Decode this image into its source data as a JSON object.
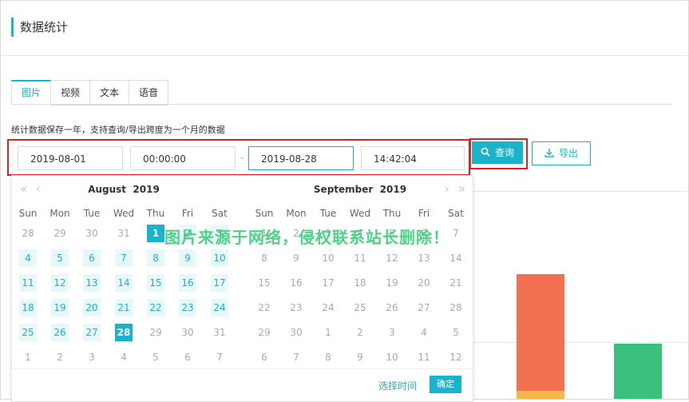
{
  "page": {
    "title": "数据统计"
  },
  "tabs": [
    {
      "label": "图片",
      "active": true
    },
    {
      "label": "视频",
      "active": false
    },
    {
      "label": "文本",
      "active": false
    },
    {
      "label": "语音",
      "active": false
    }
  ],
  "hint": "统计数据保存一年，支持查询/导出跨度为一个月的数据",
  "range": {
    "start_date": "2019-08-01",
    "start_time": "00:00:00",
    "separator": "-",
    "end_date": "2019-08-28",
    "end_time": "14:42:04"
  },
  "buttons": {
    "query": "查询",
    "export": "导出"
  },
  "calendar": {
    "weekdays": [
      "Sun",
      "Mon",
      "Tue",
      "Wed",
      "Thu",
      "Fri",
      "Sat"
    ],
    "left": {
      "month": "August",
      "year": "2019",
      "days": [
        {
          "n": "28",
          "s": "dim"
        },
        {
          "n": "29",
          "s": "dim"
        },
        {
          "n": "30",
          "s": "dim"
        },
        {
          "n": "31",
          "s": "dim"
        },
        {
          "n": "1",
          "s": "sel"
        },
        {
          "n": "2",
          "s": "cur"
        },
        {
          "n": "3",
          "s": "cur"
        },
        {
          "n": "4",
          "s": "cur"
        },
        {
          "n": "5",
          "s": "cur"
        },
        {
          "n": "6",
          "s": "cur"
        },
        {
          "n": "7",
          "s": "cur"
        },
        {
          "n": "8",
          "s": "cur"
        },
        {
          "n": "9",
          "s": "cur"
        },
        {
          "n": "10",
          "s": "cur"
        },
        {
          "n": "11",
          "s": "cur"
        },
        {
          "n": "12",
          "s": "cur"
        },
        {
          "n": "13",
          "s": "cur"
        },
        {
          "n": "14",
          "s": "cur"
        },
        {
          "n": "15",
          "s": "cur"
        },
        {
          "n": "16",
          "s": "cur"
        },
        {
          "n": "17",
          "s": "cur"
        },
        {
          "n": "18",
          "s": "cur"
        },
        {
          "n": "19",
          "s": "cur"
        },
        {
          "n": "20",
          "s": "cur"
        },
        {
          "n": "21",
          "s": "cur"
        },
        {
          "n": "22",
          "s": "cur"
        },
        {
          "n": "23",
          "s": "cur"
        },
        {
          "n": "24",
          "s": "cur"
        },
        {
          "n": "25",
          "s": "cur"
        },
        {
          "n": "26",
          "s": "cur"
        },
        {
          "n": "27",
          "s": "cur"
        },
        {
          "n": "28",
          "s": "sel"
        },
        {
          "n": "29",
          "s": "dim"
        },
        {
          "n": "30",
          "s": "dim"
        },
        {
          "n": "31",
          "s": "dim"
        },
        {
          "n": "1",
          "s": "dim"
        },
        {
          "n": "2",
          "s": "dim"
        },
        {
          "n": "3",
          "s": "dim"
        },
        {
          "n": "4",
          "s": "dim"
        },
        {
          "n": "5",
          "s": "dim"
        },
        {
          "n": "6",
          "s": "dim"
        },
        {
          "n": "7",
          "s": "dim"
        }
      ]
    },
    "right": {
      "month": "September",
      "year": "2019",
      "days": [
        {
          "n": "1",
          "s": "dim"
        },
        {
          "n": "2",
          "s": "dim"
        },
        {
          "n": "3",
          "s": "dim"
        },
        {
          "n": "4",
          "s": "dim"
        },
        {
          "n": "5",
          "s": "dim"
        },
        {
          "n": "6",
          "s": "dim"
        },
        {
          "n": "7",
          "s": "dim"
        },
        {
          "n": "8",
          "s": "dim"
        },
        {
          "n": "9",
          "s": "dim"
        },
        {
          "n": "10",
          "s": "dim"
        },
        {
          "n": "11",
          "s": "dim"
        },
        {
          "n": "12",
          "s": "dim"
        },
        {
          "n": "13",
          "s": "dim"
        },
        {
          "n": "14",
          "s": "dim"
        },
        {
          "n": "15",
          "s": "dim"
        },
        {
          "n": "16",
          "s": "dim"
        },
        {
          "n": "17",
          "s": "dim"
        },
        {
          "n": "18",
          "s": "dim"
        },
        {
          "n": "19",
          "s": "dim"
        },
        {
          "n": "20",
          "s": "dim"
        },
        {
          "n": "21",
          "s": "dim"
        },
        {
          "n": "22",
          "s": "dim"
        },
        {
          "n": "23",
          "s": "dim"
        },
        {
          "n": "24",
          "s": "dim"
        },
        {
          "n": "25",
          "s": "dim"
        },
        {
          "n": "26",
          "s": "dim"
        },
        {
          "n": "27",
          "s": "dim"
        },
        {
          "n": "28",
          "s": "dim"
        },
        {
          "n": "29",
          "s": "dim"
        },
        {
          "n": "30",
          "s": "dim"
        },
        {
          "n": "1",
          "s": "dim"
        },
        {
          "n": "2",
          "s": "dim"
        },
        {
          "n": "3",
          "s": "dim"
        },
        {
          "n": "4",
          "s": "dim"
        },
        {
          "n": "5",
          "s": "dim"
        },
        {
          "n": "6",
          "s": "dim"
        },
        {
          "n": "7",
          "s": "dim"
        },
        {
          "n": "8",
          "s": "dim"
        },
        {
          "n": "9",
          "s": "dim"
        },
        {
          "n": "10",
          "s": "dim"
        },
        {
          "n": "11",
          "s": "dim"
        },
        {
          "n": "12",
          "s": "dim"
        }
      ]
    },
    "footer": {
      "select_time": "选择时间",
      "confirm": "确定"
    }
  },
  "chart_bars": [
    {
      "color": "#f07050",
      "accent": "#f7b54a"
    },
    {
      "color": "#3cc07e"
    }
  ],
  "colors": {
    "accent": "#1bb3cb",
    "highlight_box": "#e02020"
  },
  "watermark": "图片来源于网络，侵权联系站长删除！"
}
